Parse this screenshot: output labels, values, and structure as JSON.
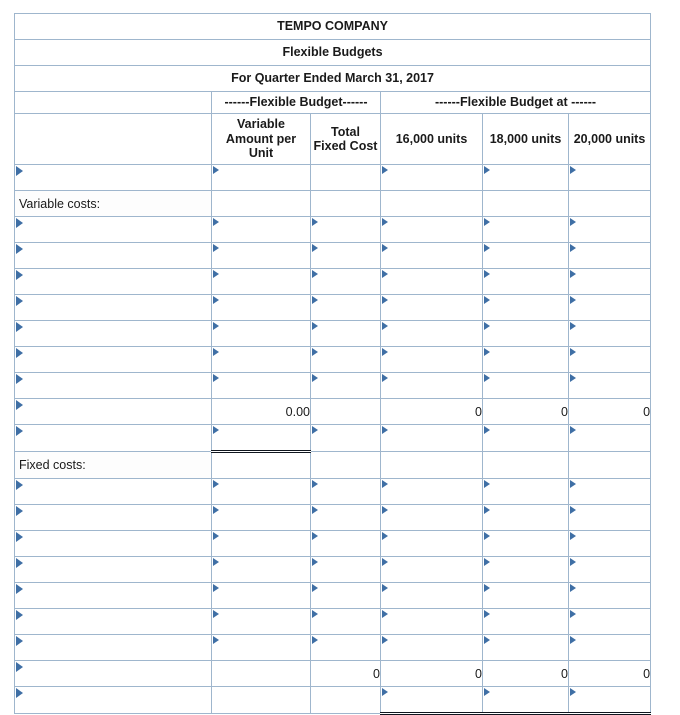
{
  "document": {
    "company": "TEMPO COMPANY",
    "statement": "Flexible Budgets",
    "period": "For Quarter Ended March 31, 2017"
  },
  "header": {
    "group_left": "------Flexible Budget------",
    "group_right": "------Flexible Budget at ------",
    "columns": {
      "label": "",
      "variable_per_unit": "Variable Amount per Unit",
      "total_fixed_cost": "Total Fixed Cost",
      "units_16000": "16,000 units",
      "units_18000": "18,000 units",
      "units_20000": "20,000 units"
    }
  },
  "sections": {
    "variable_costs_label": "Variable costs:",
    "fixed_costs_label": "Fixed costs:"
  },
  "totals": {
    "variable_subtotal": {
      "variable_per_unit": "0.00",
      "total_fixed_cost": "",
      "units_16000": "0",
      "units_18000": "0",
      "units_20000": "0"
    },
    "fixed_subtotal": {
      "variable_per_unit": "",
      "total_fixed_cost": "0",
      "units_16000": "0",
      "units_18000": "0",
      "units_20000": "0"
    }
  },
  "colors": {
    "header_blue": "#7cabde",
    "combo_border": "#5b87b8",
    "triangle": "#3f6fa5",
    "grid": "#9fb6cd",
    "rule": "#10161f"
  },
  "icons": {
    "dropdown_marker": "dropdown-triangle-icon"
  }
}
